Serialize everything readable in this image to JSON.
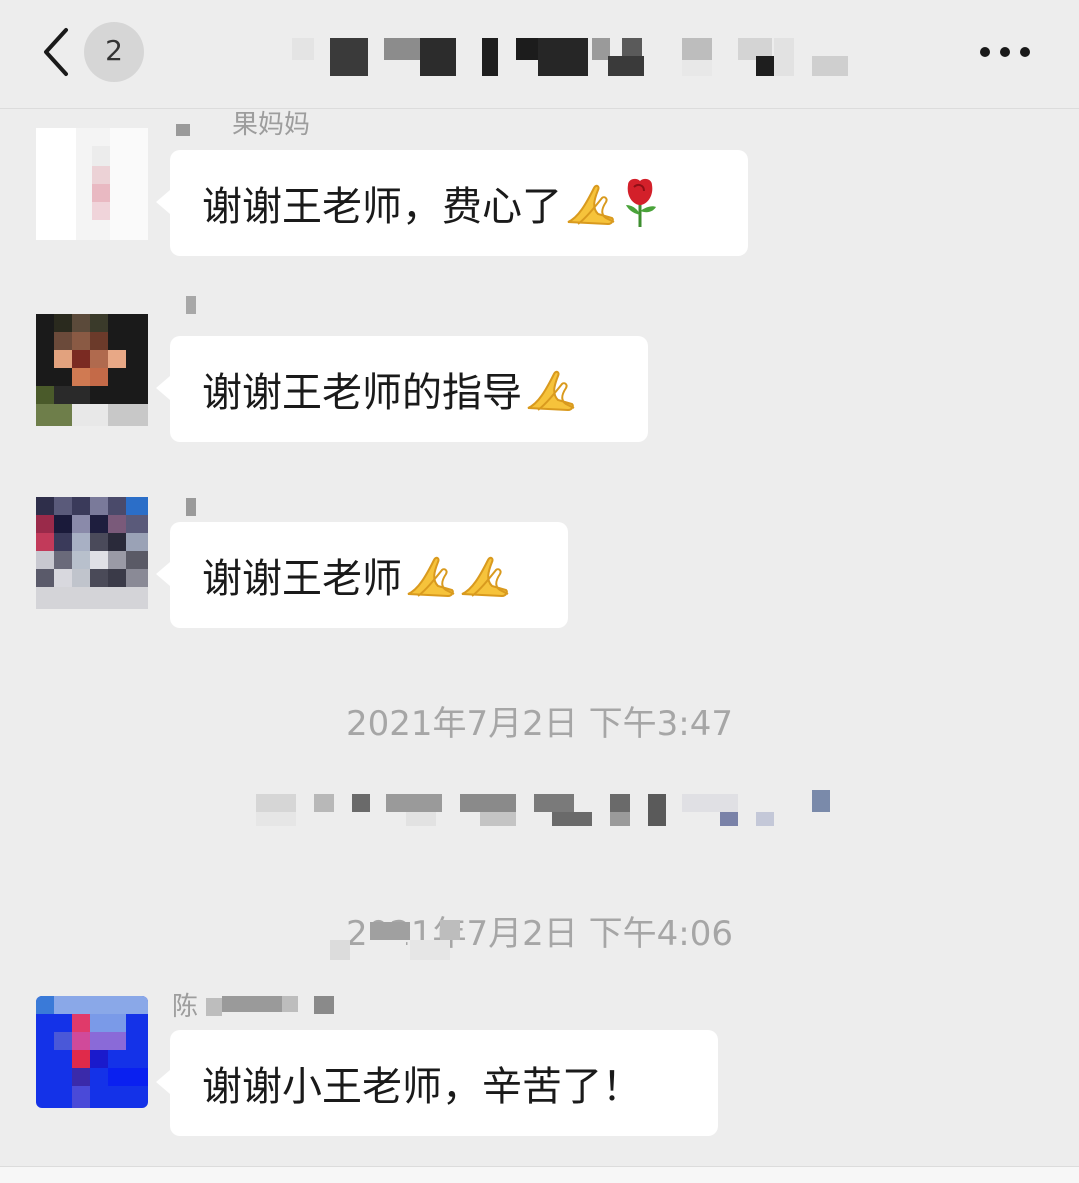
{
  "header": {
    "unread_count": "2",
    "back_icon": "chevron-left-icon",
    "more_icon": "ellipsis-icon"
  },
  "messages": [
    {
      "sender": "果妈妈",
      "text": "谢谢王老师，费心了",
      "emojis": [
        "folded-hands",
        "rose"
      ]
    },
    {
      "sender": "",
      "text": "谢谢王老师的指导",
      "emojis": [
        "folded-hands"
      ]
    },
    {
      "sender": "",
      "text": "谢谢王老师",
      "emojis": [
        "folded-hands",
        "folded-hands"
      ]
    },
    {
      "sender": "陈",
      "text": "谢谢小王老师，辛苦了！",
      "emojis": []
    }
  ],
  "timestamps": [
    "2021年7月2日 下午3:47",
    "2021年7月2日 下午4:06"
  ],
  "colors": {
    "background": "#ededed",
    "bubble": "#ffffff",
    "timestamp": "#a6a6a6"
  }
}
